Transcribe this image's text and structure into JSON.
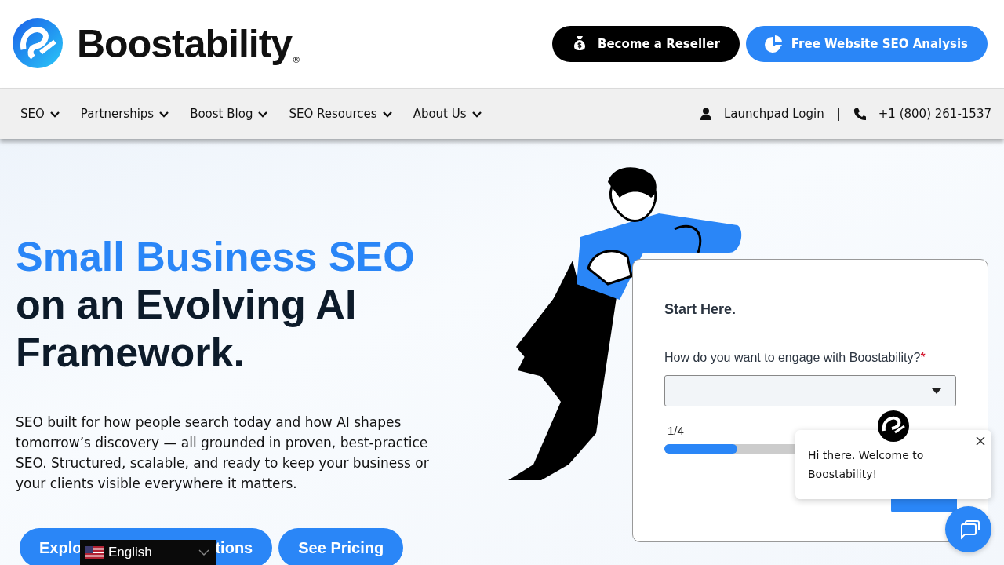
{
  "header": {
    "logo_text": "Boostability",
    "registered_mark": "®",
    "buttons": [
      {
        "label": "Become a Reseller",
        "kind": "dark"
      },
      {
        "label": "Free Website SEO Analysis",
        "kind": "primary"
      }
    ]
  },
  "nav": {
    "items": [
      {
        "label": "SEO",
        "dropdown": true
      },
      {
        "label": "Partnerships",
        "dropdown": true
      },
      {
        "label": "Boost Blog",
        "dropdown": true
      },
      {
        "label": "SEO Resources",
        "dropdown": true
      },
      {
        "label": "About Us",
        "dropdown": true
      }
    ],
    "login": "Launchpad Login",
    "separator": "|",
    "phone": "+1 (800) 261-1537"
  },
  "hero": {
    "title_highlight": "Small Business SEO",
    "title_rest": "on an Evolving AI Framework.",
    "text": "SEO built for how people search today and how AI shapes tomorrow’s discovery — all grounded in proven, best-practice SEO. Structured, scalable, and ready to keep your business or your clients visible everywhere it matters.",
    "buttons": [
      {
        "label_parts": [
          "Explo",
          "tions"
        ]
      },
      {
        "label_parts": [
          "See Pricing"
        ]
      }
    ]
  },
  "form": {
    "title": "Start Here.",
    "question": "How do you want to engage with Boostability?",
    "required_mark": "*",
    "step": "1/4",
    "level": 0.25
  },
  "chat": {
    "message": "Hi there. Welcome to Boostability!"
  },
  "language": {
    "label": "English"
  }
}
